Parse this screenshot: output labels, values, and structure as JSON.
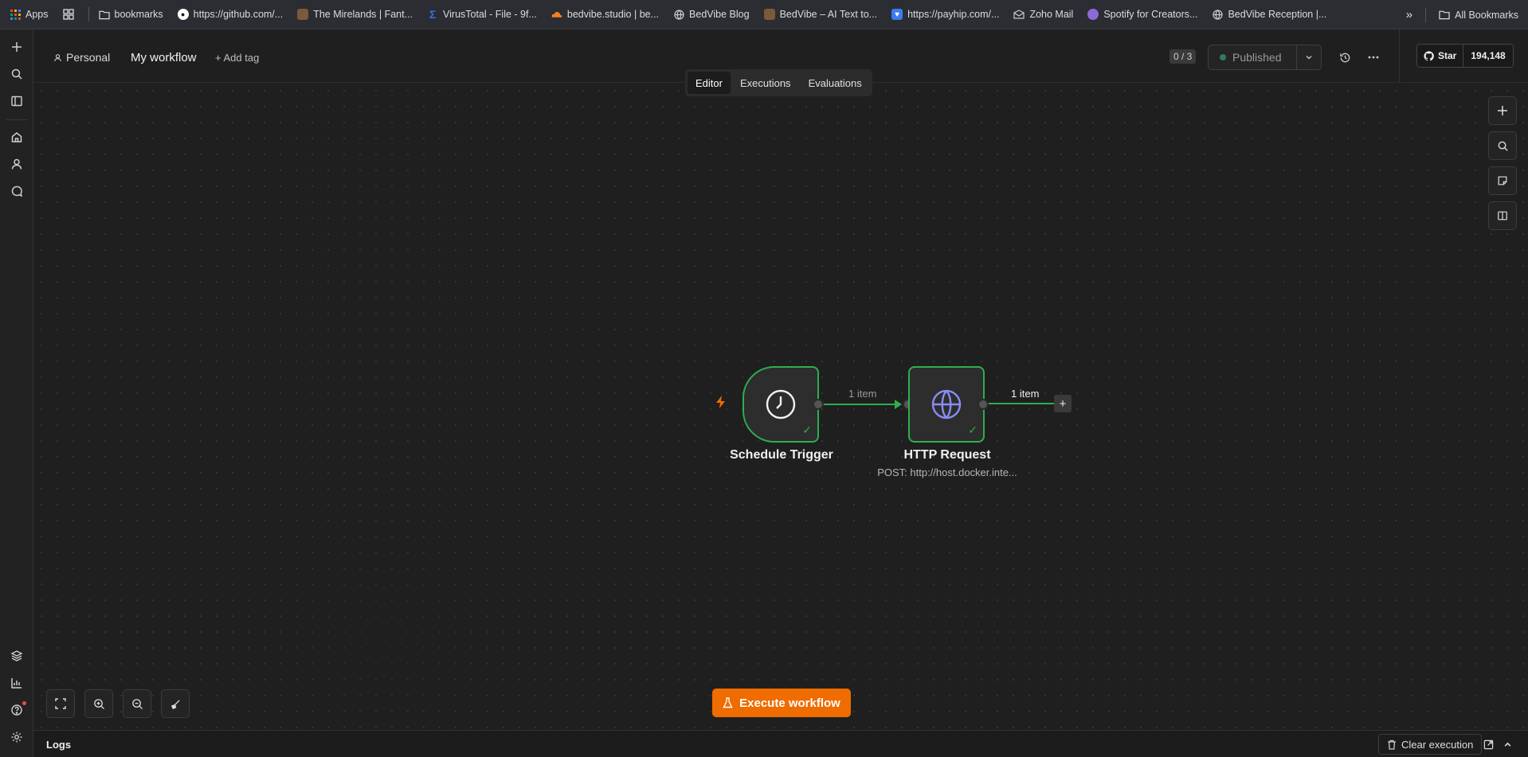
{
  "bookmarks": {
    "items": [
      {
        "label": "Apps",
        "icon": "apps-grid-icon"
      },
      {
        "label": "",
        "icon": "tab-groups-icon"
      },
      {
        "label": "bookmarks",
        "icon": "folder-icon"
      },
      {
        "label": "https://github.com/...",
        "icon": "github-icon"
      },
      {
        "label": "The Mirelands | Fant...",
        "icon": "mirelands-icon"
      },
      {
        "label": "VirusTotal - File - 9f...",
        "icon": "virustotal-icon"
      },
      {
        "label": "bedvibe.studio | be...",
        "icon": "cloudflare-icon"
      },
      {
        "label": "BedVibe Blog",
        "icon": "globe-icon"
      },
      {
        "label": "BedVibe – AI Text to...",
        "icon": "bedvibe-icon"
      },
      {
        "label": "https://payhip.com/...",
        "icon": "payhip-icon"
      },
      {
        "label": "Zoho Mail",
        "icon": "zoho-icon"
      },
      {
        "label": "Spotify for Creators...",
        "icon": "spotify-icon"
      },
      {
        "label": "BedVibe Reception |...",
        "icon": "globe-icon"
      }
    ],
    "more": "»",
    "all_bookmarks": "All Bookmarks"
  },
  "header": {
    "project": "Personal",
    "workflow_name": "My workflow",
    "add_tag": "+ Add tag",
    "counter": "0 / 3",
    "status": "Published",
    "github_star": "Star",
    "github_count": "194,148"
  },
  "tabs": [
    "Editor",
    "Executions",
    "Evaluations"
  ],
  "nodes": {
    "trigger": {
      "label": "Schedule Trigger"
    },
    "http": {
      "label": "HTTP Request",
      "subtitle": "POST: http://host.docker.inte..."
    }
  },
  "edges": {
    "first": "1 item",
    "second": "1 item"
  },
  "execute_label": "Execute workflow",
  "logs": {
    "title": "Logs",
    "clear": "Clear execution"
  },
  "colors": {
    "accent": "#ef6c00",
    "success": "#2fae4e",
    "http_globe": "#8b8cf2"
  }
}
